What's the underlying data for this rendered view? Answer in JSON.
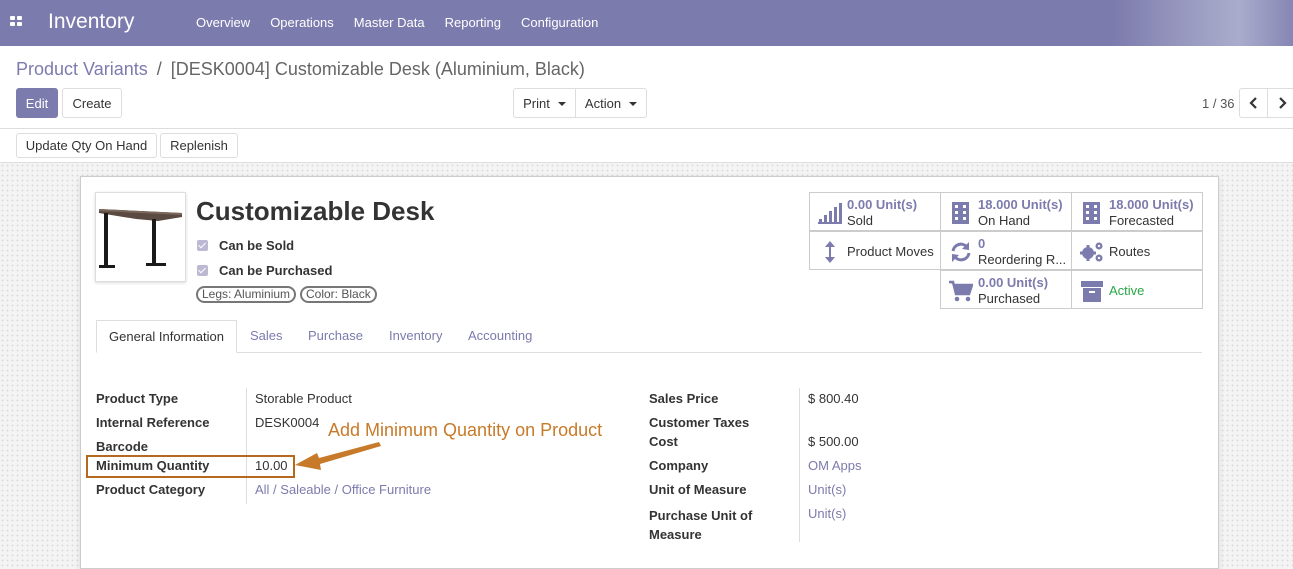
{
  "app": {
    "title": "Inventory"
  },
  "topmenu": [
    "Overview",
    "Operations",
    "Master Data",
    "Reporting",
    "Configuration"
  ],
  "breadcrumb": {
    "parent": "Product Variants",
    "separator": "/",
    "current": "[DESK0004] Customizable Desk (Aluminium, Black)"
  },
  "toolbar": {
    "edit": "Edit",
    "create": "Create",
    "print": "Print",
    "action": "Action",
    "pager": "1 / 36"
  },
  "statusbar": {
    "update_qty": "Update Qty On Hand",
    "replenish": "Replenish"
  },
  "product": {
    "name": "Customizable Desk",
    "can_be_sold": "Can be Sold",
    "can_be_purchased": "Can be Purchased",
    "tags": [
      "Legs: Aluminium",
      "Color: Black"
    ]
  },
  "smart_buttons": {
    "sold": {
      "value": "0.00 Unit(s)",
      "label": "Sold"
    },
    "on_hand": {
      "value": "18.000 Unit(s)",
      "label": "On Hand"
    },
    "forecasted": {
      "value": "18.000 Unit(s)",
      "label": "Forecasted"
    },
    "moves": {
      "label": "Product Moves"
    },
    "reordering": {
      "value": "0",
      "label": "Reordering R..."
    },
    "routes": {
      "label": "Routes"
    },
    "purchased": {
      "value": "0.00 Unit(s)",
      "label": "Purchased"
    },
    "active": {
      "label": "Active"
    }
  },
  "tabs": [
    "General Information",
    "Sales",
    "Purchase",
    "Inventory",
    "Accounting"
  ],
  "fields_left": {
    "product_type": {
      "label": "Product Type",
      "value": "Storable Product"
    },
    "internal_ref": {
      "label": "Internal Reference",
      "value": "DESK0004"
    },
    "barcode": {
      "label": "Barcode",
      "value": ""
    },
    "min_qty": {
      "label": "Minimum Quantity",
      "value": "10.00"
    },
    "category": {
      "label": "Product Category",
      "value": "All / Saleable / Office Furniture"
    }
  },
  "fields_right": {
    "sales_price": {
      "label": "Sales Price",
      "value": "$ 800.40"
    },
    "customer_taxes": {
      "label": "Customer Taxes"
    },
    "cost": {
      "label": "Cost",
      "value": "$ 500.00"
    },
    "company": {
      "label": "Company",
      "value": "OM Apps"
    },
    "uom": {
      "label": "Unit of Measure",
      "value": "Unit(s)"
    },
    "purchase_uom": {
      "label": "Purchase Unit of Measure",
      "value": "Unit(s)"
    }
  },
  "annotation": {
    "text": "Add Minimum Quantity on Product"
  },
  "colors": {
    "brand": "#7c7bad",
    "active_green": "#28a745",
    "annotation": "#b4691f"
  }
}
